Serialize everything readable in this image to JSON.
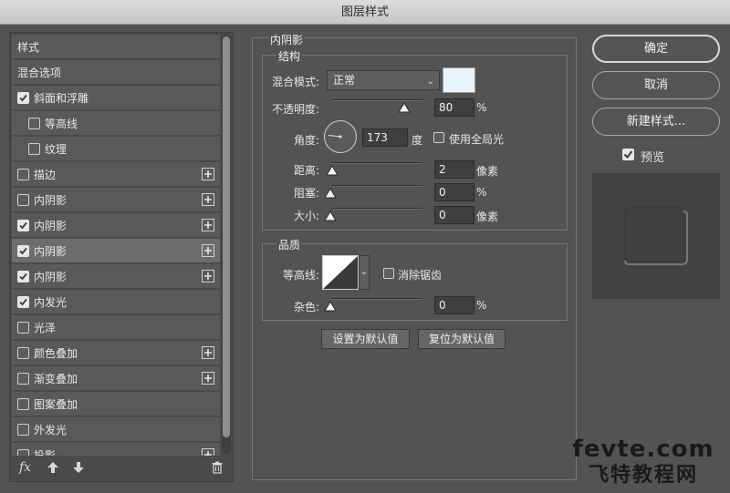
{
  "window": {
    "title": "图层样式"
  },
  "left_panel": {
    "items": [
      {
        "label": "样式",
        "type": "plain",
        "checked": false,
        "plus": false,
        "indent": false
      },
      {
        "label": "混合选项",
        "type": "plain",
        "checked": false,
        "plus": false,
        "indent": false
      },
      {
        "label": "斜面和浮雕",
        "type": "check",
        "checked": true,
        "plus": false,
        "indent": false
      },
      {
        "label": "等高线",
        "type": "check",
        "checked": false,
        "plus": false,
        "indent": true
      },
      {
        "label": "纹理",
        "type": "check",
        "checked": false,
        "plus": false,
        "indent": true
      },
      {
        "label": "描边",
        "type": "check",
        "checked": false,
        "plus": true,
        "indent": false
      },
      {
        "label": "内阴影",
        "type": "check",
        "checked": false,
        "plus": true,
        "indent": false
      },
      {
        "label": "内阴影",
        "type": "check",
        "checked": true,
        "plus": true,
        "indent": false
      },
      {
        "label": "内阴影",
        "type": "check",
        "checked": true,
        "plus": true,
        "indent": false,
        "selected": true
      },
      {
        "label": "内阴影",
        "type": "check",
        "checked": true,
        "plus": true,
        "indent": false
      },
      {
        "label": "内发光",
        "type": "check",
        "checked": true,
        "plus": false,
        "indent": false
      },
      {
        "label": "光泽",
        "type": "check",
        "checked": false,
        "plus": false,
        "indent": false
      },
      {
        "label": "颜色叠加",
        "type": "check",
        "checked": false,
        "plus": true,
        "indent": false
      },
      {
        "label": "渐变叠加",
        "type": "check",
        "checked": false,
        "plus": true,
        "indent": false
      },
      {
        "label": "图案叠加",
        "type": "check",
        "checked": false,
        "plus": false,
        "indent": false
      },
      {
        "label": "外发光",
        "type": "check",
        "checked": false,
        "plus": false,
        "indent": false
      },
      {
        "label": "投影",
        "type": "check",
        "checked": false,
        "plus": true,
        "indent": false
      }
    ],
    "footer": {
      "fx_label": "fx"
    }
  },
  "inner_shadow": {
    "section_title": "内阴影",
    "structure": {
      "title": "结构",
      "blend_mode_label": "混合模式:",
      "blend_mode_value": "正常",
      "color": "#e8f4ff",
      "opacity_label": "不透明度:",
      "opacity_value": "80",
      "opacity_unit": "%",
      "opacity_fraction": 0.8,
      "angle_label": "角度:",
      "angle_value": "173",
      "angle_unit": "度",
      "global_light_label": "使用全局光",
      "global_light_checked": false,
      "distance_label": "距离:",
      "distance_value": "2",
      "distance_unit": "像素",
      "choke_label": "阻塞:",
      "choke_value": "0",
      "choke_unit": "%",
      "size_label": "大小:",
      "size_value": "0",
      "size_unit": "像素"
    },
    "quality": {
      "title": "品质",
      "contour_label": "等高线:",
      "anti_alias_label": "消除锯齿",
      "anti_alias_checked": false,
      "noise_label": "杂色:",
      "noise_value": "0",
      "noise_unit": "%"
    },
    "buttons": {
      "set_default": "设置为默认值",
      "reset_default": "复位为默认值"
    }
  },
  "right_panel": {
    "ok": "确定",
    "cancel": "取消",
    "new_style": "新建样式...",
    "preview_label": "预览",
    "preview_checked": true
  },
  "watermark": {
    "line1": "fevte.com",
    "line2": "飞特教程网"
  }
}
